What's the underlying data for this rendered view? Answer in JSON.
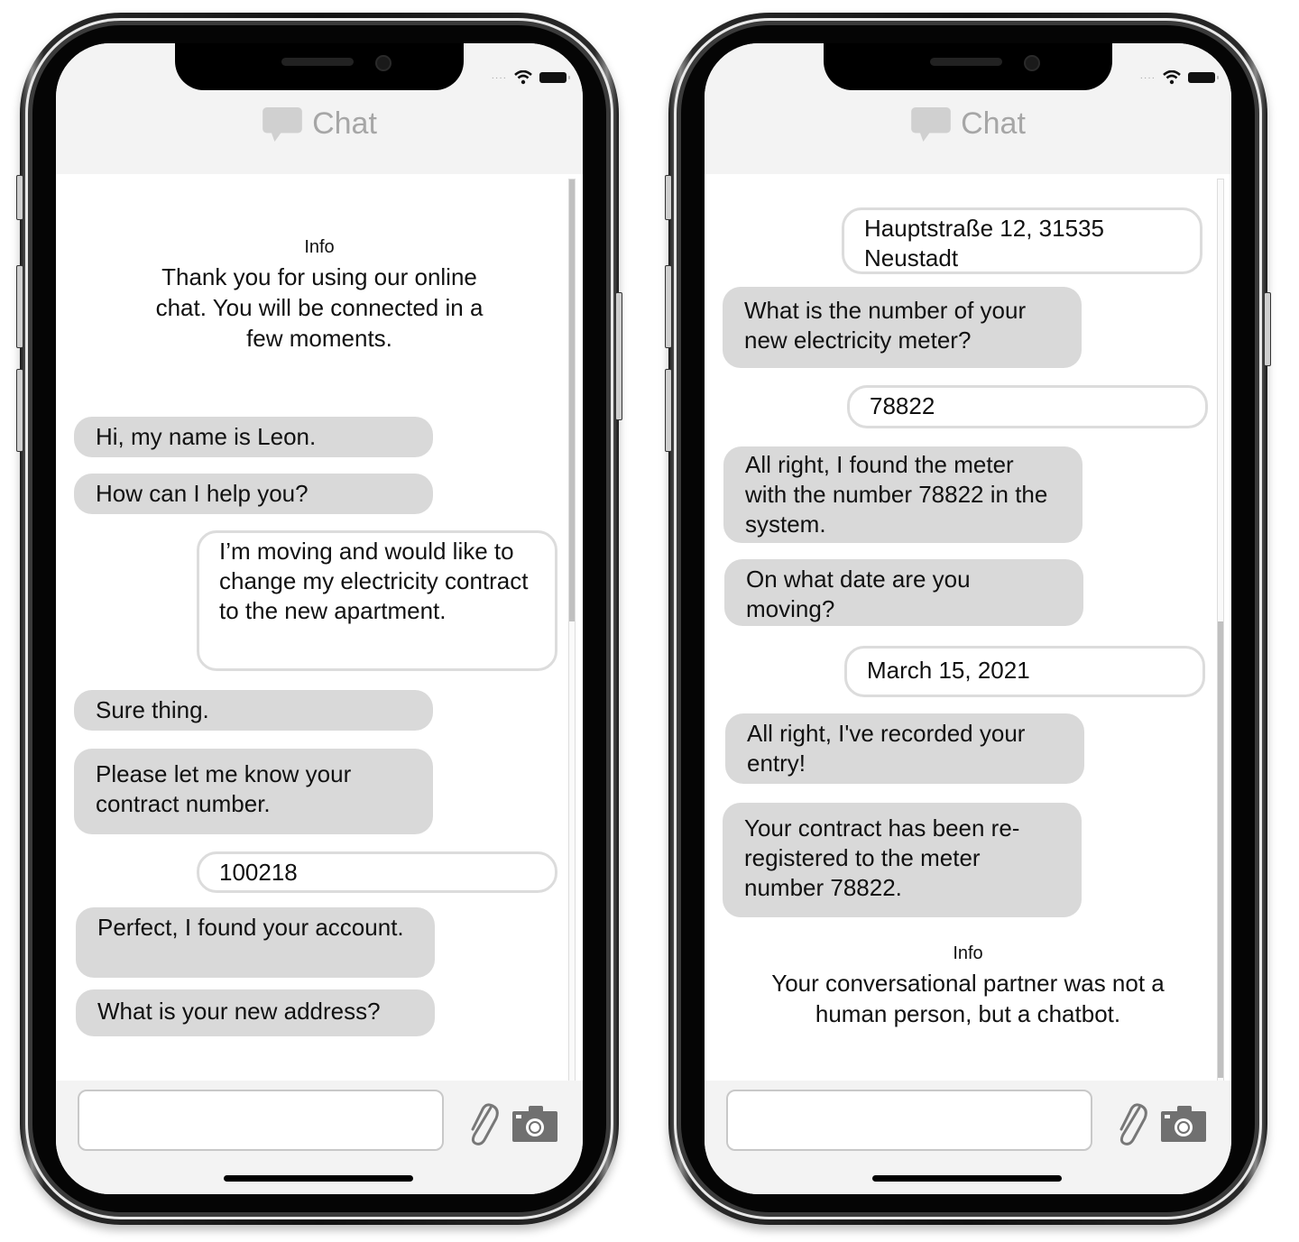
{
  "phones": [
    {
      "header": {
        "title": "Chat",
        "icon": "chat-bubble-icon"
      },
      "status": {
        "signal": "····",
        "wifi": "wifi-icon",
        "battery": "battery-icon"
      },
      "info_top": {
        "label": "Info",
        "text": "Thank you for using our online chat. You will be connected in a few moments."
      },
      "messages": [
        {
          "sender": "bot",
          "text": "Hi, my name is Leon."
        },
        {
          "sender": "bot",
          "text": "How can I help you?"
        },
        {
          "sender": "user",
          "text": "I’m moving and would like to change my electricity contract to the new apartment."
        },
        {
          "sender": "bot",
          "text": "Sure thing."
        },
        {
          "sender": "bot",
          "text": "Please let me know your contract number."
        },
        {
          "sender": "user",
          "text": "100218"
        },
        {
          "sender": "bot",
          "text": "Perfect, I found your account."
        },
        {
          "sender": "bot",
          "text": "What is your new address?"
        }
      ],
      "scroll_position": 0.0,
      "composer": {
        "input_value": "",
        "attach_icon": "paperclip-icon",
        "camera_icon": "camera-icon"
      }
    },
    {
      "header": {
        "title": "Chat",
        "icon": "chat-bubble-icon"
      },
      "status": {
        "signal": "····",
        "wifi": "wifi-icon",
        "battery": "battery-icon"
      },
      "messages": [
        {
          "sender": "user",
          "text": "Hauptstraße 12, 31535 Neustadt"
        },
        {
          "sender": "bot",
          "text": "What is the number of your new electricity meter?"
        },
        {
          "sender": "user",
          "text": "78822"
        },
        {
          "sender": "bot",
          "text": "All right, I found the meter with the number 78822 in the system."
        },
        {
          "sender": "bot",
          "text": "On what date are you moving?"
        },
        {
          "sender": "user",
          "text": "March 15, 2021"
        },
        {
          "sender": "bot",
          "text": "All right, I've recorded your entry!"
        },
        {
          "sender": "bot",
          "text": "Your contract has been re-registered to the meter number 78822."
        }
      ],
      "info_bottom": {
        "label": "Info",
        "text": "Your conversational partner was not a human person, but a chatbot."
      },
      "scroll_position": 1.0,
      "composer": {
        "input_value": "",
        "attach_icon": "paperclip-icon",
        "camera_icon": "camera-icon"
      }
    }
  ]
}
